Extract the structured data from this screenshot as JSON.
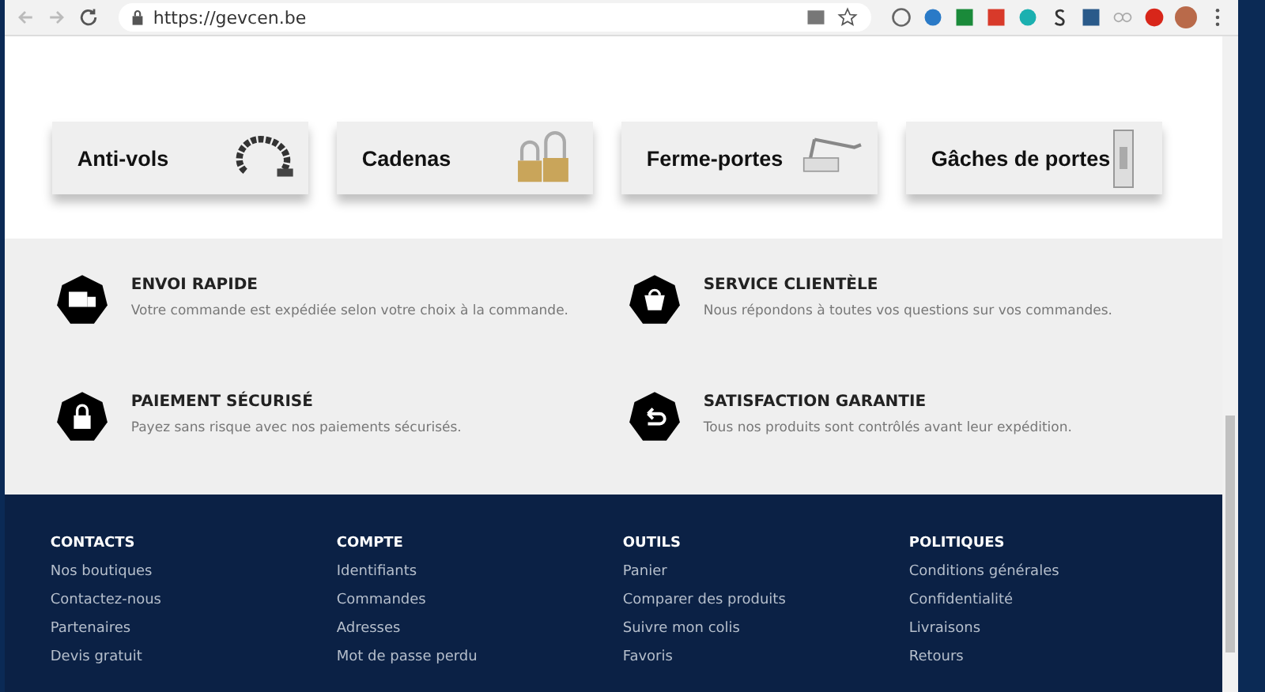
{
  "browser": {
    "url": "https://gevcen.be"
  },
  "categories": [
    {
      "label": "Anti-vols",
      "kind": "chain"
    },
    {
      "label": "Cadenas",
      "kind": "padlock"
    },
    {
      "label": "Ferme-portes",
      "kind": "closer"
    },
    {
      "label": "Gâches de portes",
      "kind": "strike"
    }
  ],
  "features": [
    {
      "title": "ENVOI RAPIDE",
      "text": "Votre commande est expédiée selon votre choix à la commande.",
      "kind": "truck"
    },
    {
      "title": "SERVICE CLIENTÈLE",
      "text": "Nous répondons à toutes vos questions sur vos commandes.",
      "kind": "bag"
    },
    {
      "title": "PAIEMENT SÉCURISÉ",
      "text": "Payez sans risque avec nos paiements sécurisés.",
      "kind": "lock"
    },
    {
      "title": "SATISFACTION GARANTIE",
      "text": "Tous nos produits sont contrôlés avant leur expédition.",
      "kind": "return"
    }
  ],
  "footer": [
    {
      "heading": "CONTACTS",
      "links": [
        "Nos boutiques",
        "Contactez-nous",
        "Partenaires",
        "Devis gratuit"
      ]
    },
    {
      "heading": "COMPTE",
      "links": [
        "Identifiants",
        "Commandes",
        "Adresses",
        "Mot de passe perdu"
      ]
    },
    {
      "heading": "OUTILS",
      "links": [
        "Panier",
        "Comparer des produits",
        "Suivre mon colis",
        "Favoris"
      ]
    },
    {
      "heading": "POLITIQUES",
      "links": [
        "Conditions générales",
        "Confidentialité",
        "Livraisons",
        "Retours"
      ]
    }
  ]
}
